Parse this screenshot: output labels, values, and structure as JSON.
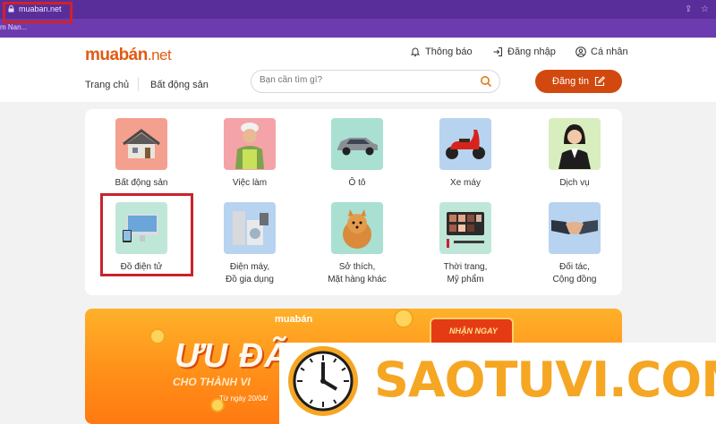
{
  "browser": {
    "url": "muaban.net",
    "bookmark": "m Nan..."
  },
  "header": {
    "logo_main": "muabán",
    "logo_tld": ".net",
    "notifications": "Thông báo",
    "login": "Đăng nhập",
    "personal": "Cá nhân",
    "nav": [
      "Trang chủ",
      "Bất động sản"
    ],
    "search_placeholder": "Bạn cần tìm gì?",
    "post_button": "Đăng tin"
  },
  "categories": [
    {
      "label": "Bất động sản",
      "icon": "house-icon"
    },
    {
      "label": "Việc làm",
      "icon": "worker-icon"
    },
    {
      "label": "Ô tô",
      "icon": "car-icon"
    },
    {
      "label": "Xe máy",
      "icon": "scooter-icon"
    },
    {
      "label": "Dịch vụ",
      "icon": "service-agent-icon"
    },
    {
      "label": "Đồ điện tử",
      "icon": "computer-icon"
    },
    {
      "label": "Điện máy,\nĐồ gia dụng",
      "icon": "appliance-icon"
    },
    {
      "label": "Sở thích,\nMặt hàng khác",
      "icon": "dog-icon"
    },
    {
      "label": "Thời trang,\nMỹ phẩm",
      "icon": "makeup-palette-icon"
    },
    {
      "label": "Đối tác,\nCộng đồng",
      "icon": "handshake-icon"
    }
  ],
  "banner": {
    "brand": "muabán",
    "title": "ƯU ĐÃI",
    "subtitle": "CHO THÀNH VI",
    "date": "Từ ngày 20/04/",
    "badge": "NHẬN NGAY"
  },
  "watermark": {
    "text": "SAOTUVI.COM"
  },
  "colors": {
    "brand": "#d2490f",
    "browser": "#6c3bb0",
    "highlight": "#c8232c",
    "watermark": "#f5a623"
  }
}
